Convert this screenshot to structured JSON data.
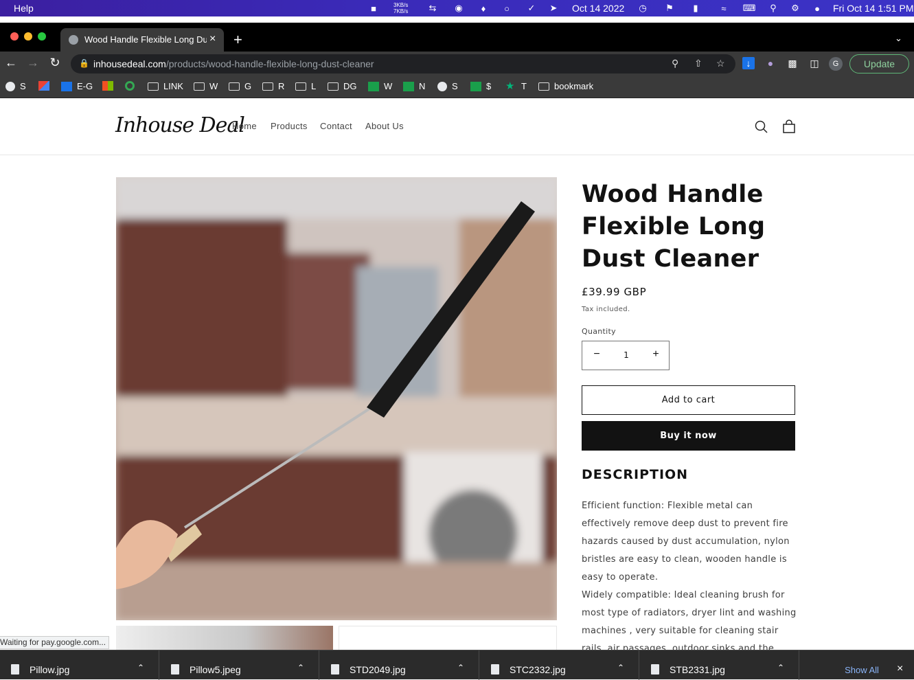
{
  "menubar": {
    "app_menu": "Help",
    "net_up": "3KB/s",
    "net_down": "7KB/s",
    "date_short": "Oct 14 2022",
    "datetime": "Fri Oct 14  1:51 PM"
  },
  "browser": {
    "tab_title": "Wood Handle Flexible Long Dust Cleaner",
    "url_domain": "inhousedeal.com",
    "url_path": "/products/wood-handle-flexible-long-dust-cleaner",
    "update_label": "Update",
    "profile_initial": "G",
    "bookmarks": [
      {
        "label": "S",
        "icon": "globe-icon"
      },
      {
        "label": "",
        "icon": "gmail-icon"
      },
      {
        "label": "E-G",
        "icon": "outlook-icon"
      },
      {
        "label": "",
        "icon": "microsoft-icon"
      },
      {
        "label": "",
        "icon": "grammarly-icon"
      },
      {
        "label": "LINK",
        "icon": "folder-icon"
      },
      {
        "label": "W",
        "icon": "folder-icon"
      },
      {
        "label": "G",
        "icon": "folder-icon"
      },
      {
        "label": "R",
        "icon": "folder-icon"
      },
      {
        "label": "L",
        "icon": "folder-icon"
      },
      {
        "label": "DG",
        "icon": "folder-icon"
      },
      {
        "label": "W",
        "icon": "sheets-icon"
      },
      {
        "label": "N",
        "icon": "sheets-icon"
      },
      {
        "label": "S",
        "icon": "globe-icon"
      },
      {
        "label": "$",
        "icon": "sheets-icon"
      },
      {
        "label": "T",
        "icon": "star-icon"
      },
      {
        "label": "bookmark",
        "icon": "folder-icon"
      }
    ]
  },
  "site": {
    "logo": "Inhouse Deal",
    "nav": [
      "Home",
      "Products",
      "Contact",
      "About Us"
    ]
  },
  "product": {
    "title": "Wood Handle Flexible Long Dust Cleaner",
    "price": "£39.99 GBP",
    "tax_note": "Tax included.",
    "quantity_label": "Quantity",
    "quantity_value": "1",
    "add_to_cart": "Add to cart",
    "buy_now": "Buy it now",
    "description_heading": "DESCRIPTION",
    "description_p1": "Efficient function: Flexible metal can effectively remove deep dust to prevent fire hazards caused by dust accumulation, nylon bristles are easy to clean, wooden handle is easy to operate.",
    "description_p2": "Widely compatible: Ideal cleaning brush for most type of radiators, dryer lint and washing machines , very suitable for cleaning stair rails, air passages, outdoor sinks and the bottom of"
  },
  "status": "Waiting for pay.google.com...",
  "downloads": {
    "files": [
      "Pillow.jpg",
      "Pillow5.jpeg",
      "STD2049.jpg",
      "STC2332.jpg",
      "STB2331.jpg"
    ],
    "show_all": "Show All"
  }
}
